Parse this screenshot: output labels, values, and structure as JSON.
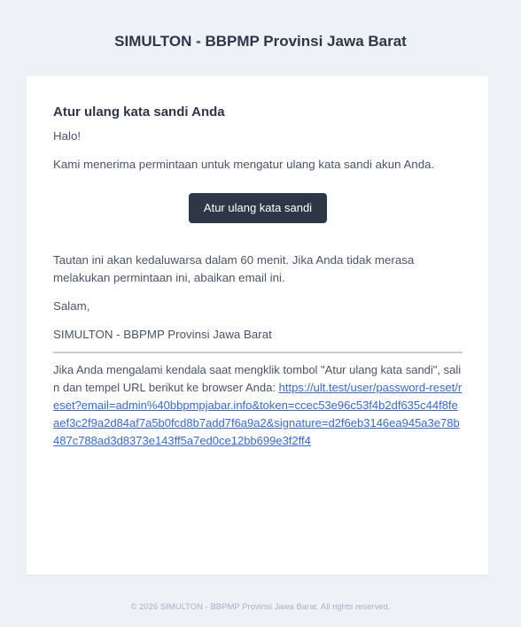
{
  "header": {
    "title": "SIMULTON - BBPMP Provinsi Jawa Barat"
  },
  "body": {
    "heading": "Atur ulang kata sandi Anda",
    "greeting": "Halo!",
    "intro": "Kami menerima permintaan untuk mengatur ulang kata sandi akun Anda.",
    "button_label": "Atur ulang kata sandi",
    "expire_notice": "Tautan ini akan kedaluwarsa dalam 60 menit. Jika Anda tidak merasa melakukan permintaan ini, abaikan email ini.",
    "salutation": "Salam,",
    "signature": "SIMULTON - BBPMP Provinsi Jawa Barat"
  },
  "subcopy": {
    "text": "Jika Anda mengalami kendala saat mengklik tombol \"Atur ulang kata sandi\", salin dan tempel URL berikut ke browser Anda: ",
    "url": "https://ult.test/user/password-reset/reset?email=admin%40bbpmpjabar.info&token=ccec53e96c53f4b2df635c44f8feaef3c2f9a2d84af7a5b0fcd8b7add7f6a9a2&signature=d2f6eb3146ea945a3e78b487c788ad3d8373e143ff5a7ed0ce12bb699e3f2ff4"
  },
  "footer": {
    "copyright": "© 2026 SIMULTON - BBPMP Provinsi Jawa Barat. All rights reserved."
  },
  "colors": {
    "page_bg": "#edf2f7",
    "card_bg": "#ffffff",
    "button_bg": "#2d3748",
    "link": "#3869d4"
  }
}
